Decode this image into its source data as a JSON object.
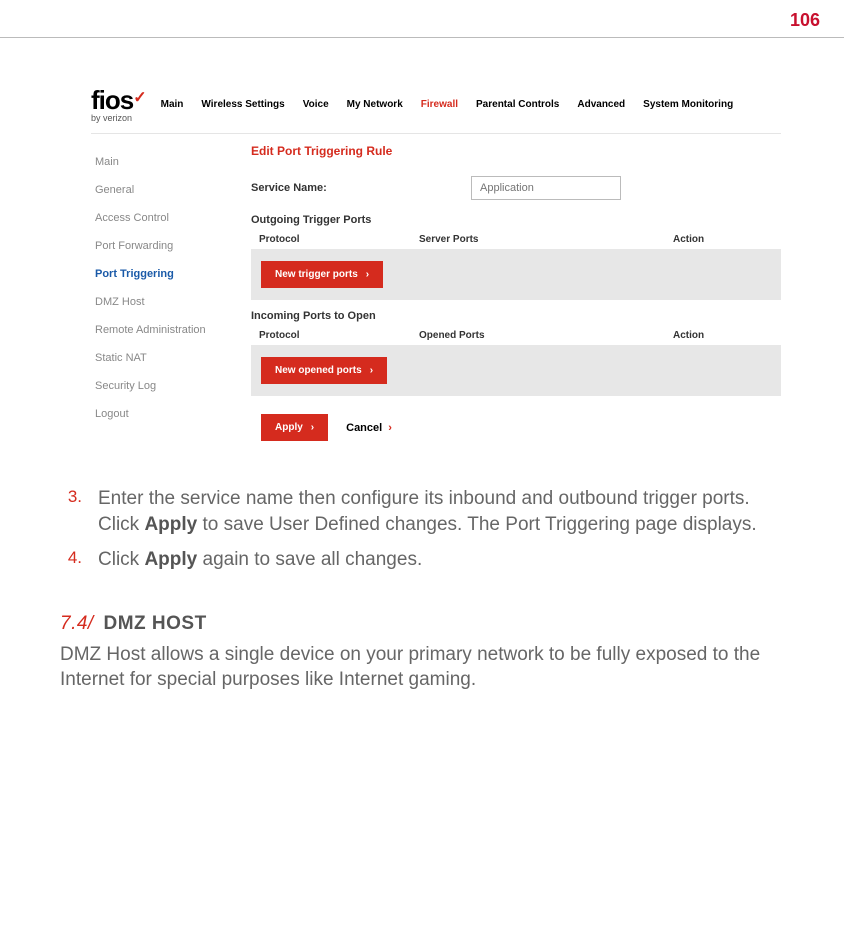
{
  "page_number": "106",
  "logo": {
    "text": "fios",
    "sub": "by verizon"
  },
  "nav": {
    "items": [
      "Main",
      "Wireless Settings",
      "Voice",
      "My Network",
      "Firewall",
      "Parental Controls",
      "Advanced",
      "System Monitoring"
    ],
    "active_index": 4
  },
  "sidebar": {
    "items": [
      "Main",
      "General",
      "Access Control",
      "Port Forwarding",
      "Port Triggering",
      "DMZ Host",
      "Remote Administration",
      "Static NAT",
      "Security Log",
      "Logout"
    ],
    "active_index": 4
  },
  "panel": {
    "title": "Edit Port Triggering Rule",
    "service_label": "Service Name:",
    "service_placeholder": "Application",
    "outgoing": {
      "title": "Outgoing Trigger Ports",
      "cols": [
        "Protocol",
        "Server Ports",
        "Action"
      ],
      "button": "New trigger ports"
    },
    "incoming": {
      "title": "Incoming Ports to Open",
      "cols": [
        "Protocol",
        "Opened Ports",
        "Action"
      ],
      "button": "New opened ports"
    },
    "apply": "Apply",
    "cancel": "Cancel"
  },
  "steps": {
    "s3_num": "3.",
    "s3a": "Enter the service name then configure its inbound and outbound trigger ports. Click ",
    "s3b": "Apply",
    "s3c": " to save User Defined changes. The Port Triggering page displays.",
    "s4_num": "4.",
    "s4a": "Click ",
    "s4b": "Apply",
    "s4c": " again to save all changes."
  },
  "section": {
    "num": "7.4/",
    "title": "DMZ HOST",
    "body": "DMZ Host allows a single device on your primary network to be fully exposed to the Internet for special purposes like Internet gaming."
  }
}
